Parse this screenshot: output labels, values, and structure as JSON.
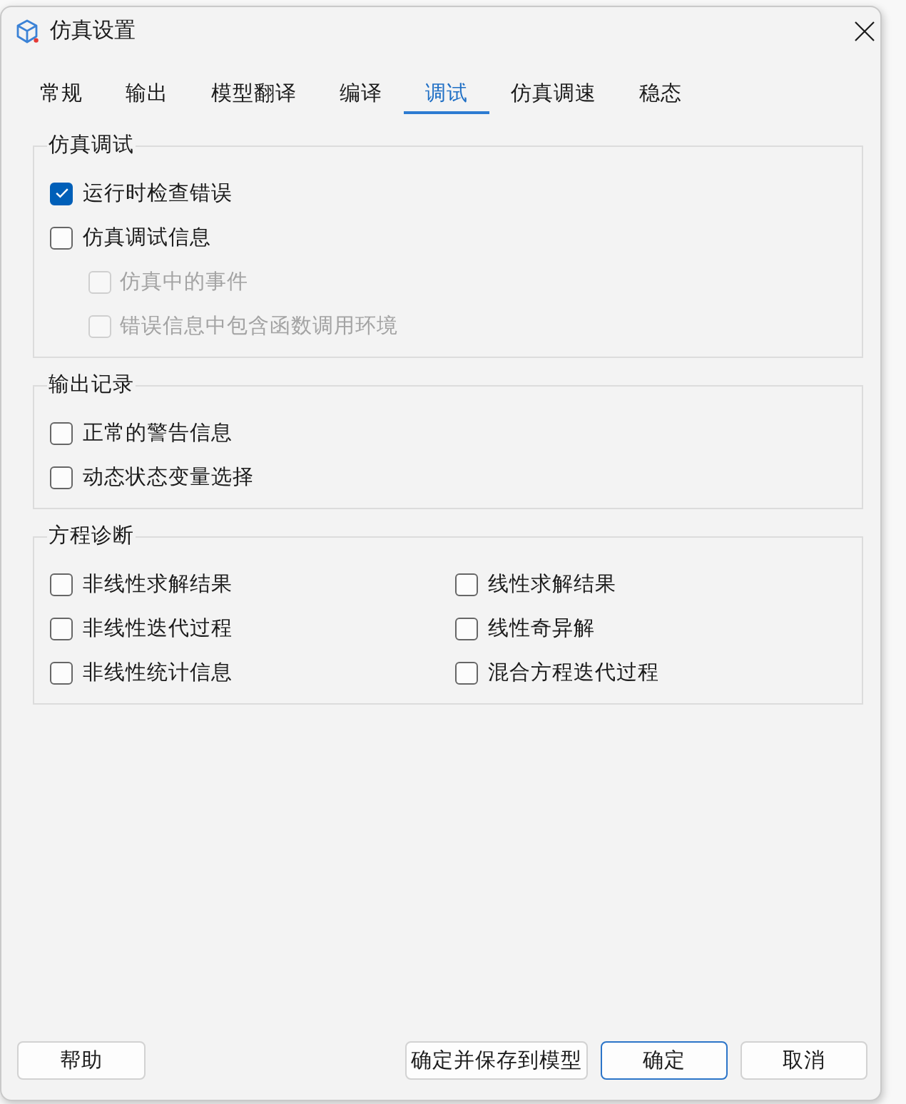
{
  "window": {
    "title": "仿真设置"
  },
  "tabs": [
    {
      "label": "常规",
      "selected": false
    },
    {
      "label": "输出",
      "selected": false
    },
    {
      "label": "模型翻译",
      "selected": false
    },
    {
      "label": "编译",
      "selected": false
    },
    {
      "label": "调试",
      "selected": true
    },
    {
      "label": "仿真调速",
      "selected": false
    },
    {
      "label": "稳态",
      "selected": false
    }
  ],
  "groups": [
    {
      "title": "仿真调试",
      "kind": "list",
      "options": [
        {
          "label": "运行时检查错误",
          "checked": true,
          "disabled": false
        },
        {
          "label": "仿真调试信息",
          "checked": false,
          "disabled": false,
          "children": [
            {
              "label": "仿真中的事件",
              "checked": false,
              "disabled": true
            },
            {
              "label": "错误信息中包含函数调用环境",
              "checked": false,
              "disabled": true
            }
          ]
        }
      ]
    },
    {
      "title": "输出记录",
      "kind": "list",
      "options": [
        {
          "label": "正常的警告信息",
          "checked": false,
          "disabled": false
        },
        {
          "label": "动态状态变量选择",
          "checked": false,
          "disabled": false
        }
      ]
    },
    {
      "title": "方程诊断",
      "kind": "grid",
      "options": [
        {
          "label": "非线性求解结果",
          "checked": false,
          "disabled": false
        },
        {
          "label": "线性求解结果",
          "checked": false,
          "disabled": false
        },
        {
          "label": "非线性迭代过程",
          "checked": false,
          "disabled": false
        },
        {
          "label": "线性奇异解",
          "checked": false,
          "disabled": false
        },
        {
          "label": "非线性统计信息",
          "checked": false,
          "disabled": false
        },
        {
          "label": "混合方程迭代过程",
          "checked": false,
          "disabled": false
        }
      ]
    }
  ],
  "footer": {
    "help_button": {
      "label": "帮助"
    },
    "action_buttons": [
      {
        "label": "确定并保存到模型",
        "default": false
      },
      {
        "label": "确定",
        "default": true
      },
      {
        "label": "取消",
        "default": false
      }
    ]
  }
}
